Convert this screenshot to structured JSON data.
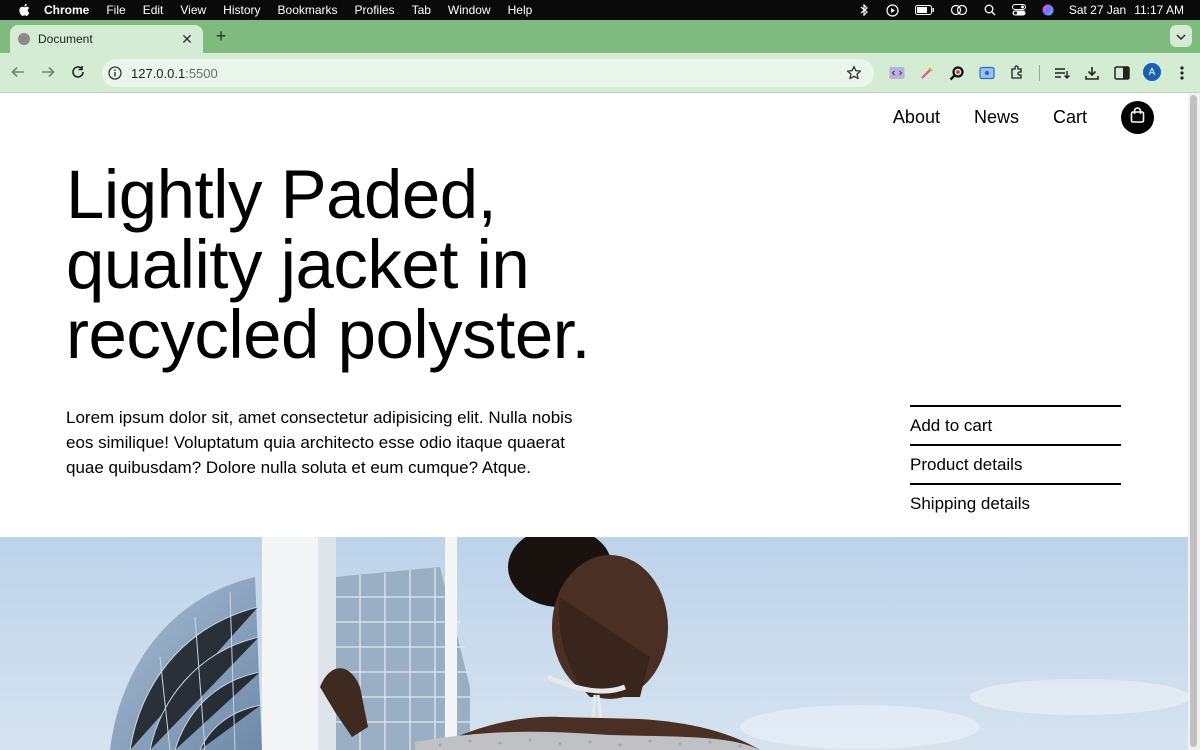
{
  "menubar": {
    "app": "Chrome",
    "menus": [
      "File",
      "Edit",
      "View",
      "History",
      "Bookmarks",
      "Profiles",
      "Tab",
      "Window",
      "Help"
    ],
    "date": "Sat 27 Jan",
    "time": "11:17 AM"
  },
  "browser": {
    "tab_title": "Document",
    "new_tab_label": "+",
    "url_host": "127.0.0.1",
    "url_port": ":5500",
    "profile_initial": "A"
  },
  "site": {
    "nav": [
      "About",
      "News",
      "Cart"
    ],
    "headline": "Lightly Paded, quality jacket in recycled polyster.",
    "lead": "Lorem ipsum dolor sit, amet consectetur adipisicing elit. Nulla nobis eos similique! Voluptatum quia architecto esse odio itaque quaerat quae quibusdam? Dolore nulla soluta et eum cumque? Atque.",
    "actions": [
      "Add to cart",
      "Product details",
      "Shipping details"
    ]
  },
  "colors": {
    "tabstrip": "#7fba7f",
    "toolbar": "#d3ecd3",
    "sky": "#c5d8ec"
  }
}
